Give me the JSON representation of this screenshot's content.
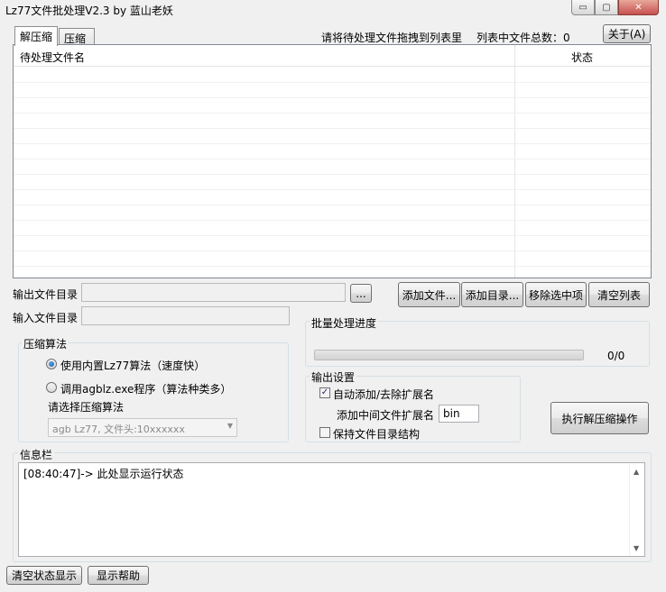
{
  "window": {
    "title": "Lz77文件批处理V2.3 by 蓝山老妖",
    "minimize": "▭",
    "maximize": "▢",
    "close": "✕"
  },
  "tabs": [
    {
      "label": "解压缩"
    },
    {
      "label": "压缩"
    }
  ],
  "header": {
    "drag_hint": "请将待处理文件拖拽到列表里",
    "count_label": "列表中文件总数：0",
    "about_button": "关于(A)"
  },
  "file_list": {
    "columns": [
      "待处理文件名",
      "状态"
    ],
    "rows": []
  },
  "output_dir": {
    "label": "输出文件目录",
    "value": "",
    "browse_button": "..."
  },
  "input_dir": {
    "label": "输入文件目录",
    "value": ""
  },
  "list_buttons": {
    "add_file": "添加文件...",
    "add_dir": "添加目录...",
    "remove_selected": "移除选中项",
    "clear_list": "清空列表"
  },
  "algorithm": {
    "title": "压缩算法",
    "option_builtin": "使用内置Lz77算法（速度快）",
    "option_external": "调用agblz.exe程序（算法种类多）",
    "select_label": "请选择压缩算法",
    "selected": "agb Lz77, 文件头:10xxxxxx",
    "builtin_checked": true
  },
  "progress": {
    "title": "批量处理进度",
    "text": "0/0",
    "fraction": 0
  },
  "output_settings": {
    "title": "输出设置",
    "auto_ext_label": "自动添加/去除扩展名",
    "auto_ext_checked": true,
    "mid_ext_label": "添加中间文件扩展名",
    "mid_ext_value": "bin",
    "keep_structure_label": "保持文件目录结构",
    "keep_structure_checked": false
  },
  "execute_button": "执行解压缩操作",
  "info": {
    "title": "信息栏",
    "log": "[08:40:47]-> 此处显示运行状态"
  },
  "bottom_buttons": {
    "clear_status": "清空状态显示",
    "show_help": "显示帮助"
  }
}
